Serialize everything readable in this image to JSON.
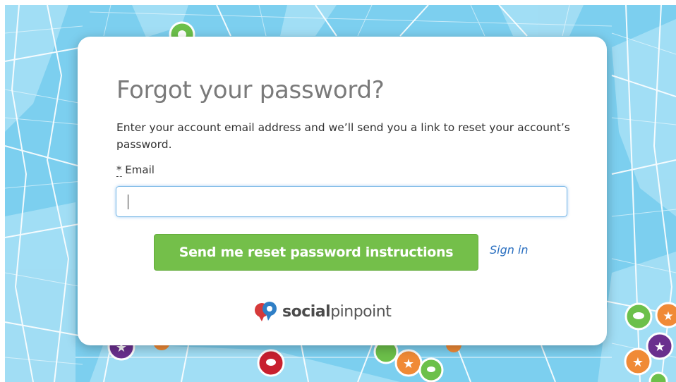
{
  "form": {
    "title": "Forgot your password?",
    "description": "Enter your account email address and we’ll send you a link to reset your account’s password.",
    "required_marker": "*",
    "email_label": "Email",
    "email_value": "",
    "submit_label": "Send me reset password instructions",
    "signin_label": "Sign in"
  },
  "brand": {
    "name_bold": "social",
    "name_regular": "pinpoint",
    "logo_icon": "socialpinpoint-logo-icon"
  },
  "colors": {
    "map_background": "#7ccfef",
    "submit_button": "#74bf4a",
    "link": "#2a6fc0",
    "title": "#7a7a7a",
    "marker_green": "#6cc04a",
    "marker_orange": "#f08a36",
    "marker_purple": "#6a2f8e",
    "marker_red": "#c8202f"
  }
}
